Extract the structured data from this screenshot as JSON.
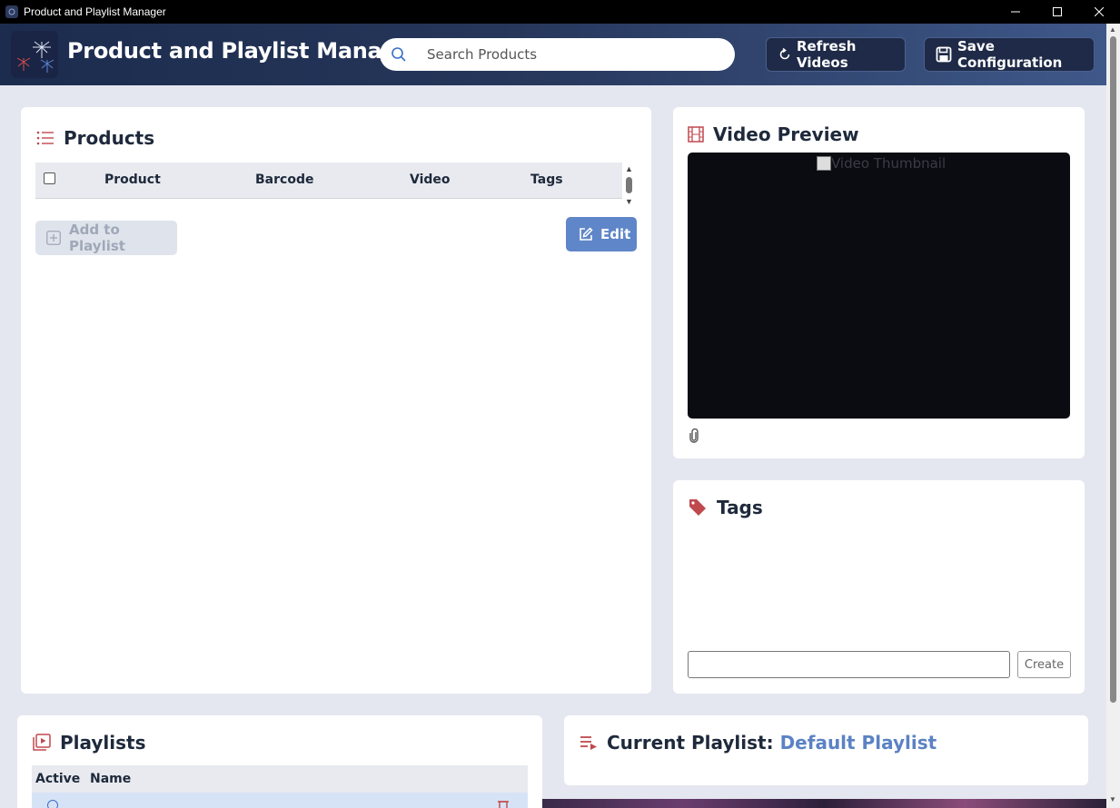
{
  "window": {
    "title": "Product and Playlist Manager",
    "controls": [
      "minimize",
      "maximize",
      "close"
    ]
  },
  "header": {
    "app_title": "Product and Playlist Manager",
    "search_placeholder": "Search Products",
    "refresh_label": "Refresh Videos",
    "save_label": "Save Configuration"
  },
  "products": {
    "title": "Products",
    "columns": [
      "Product",
      "Barcode",
      "Video",
      "Tags"
    ],
    "rows": [],
    "add_label": "Add to Playlist",
    "add_enabled": false,
    "edit_label": "Edit"
  },
  "video": {
    "title": "Video Preview",
    "thumbnail_alt": "Video Thumbnail"
  },
  "tags": {
    "title": "Tags",
    "input_value": "",
    "create_label": "Create"
  },
  "playlists": {
    "title": "Playlists",
    "columns": [
      "Active",
      "Name"
    ]
  },
  "current_playlist": {
    "label": "Current Playlist:",
    "name": "Default Playlist"
  },
  "colors": {
    "accent": "#5f86c8",
    "icon_red": "#c0494e",
    "header_dark": "#1c2c4e",
    "page_bg": "#e5e7f0"
  }
}
